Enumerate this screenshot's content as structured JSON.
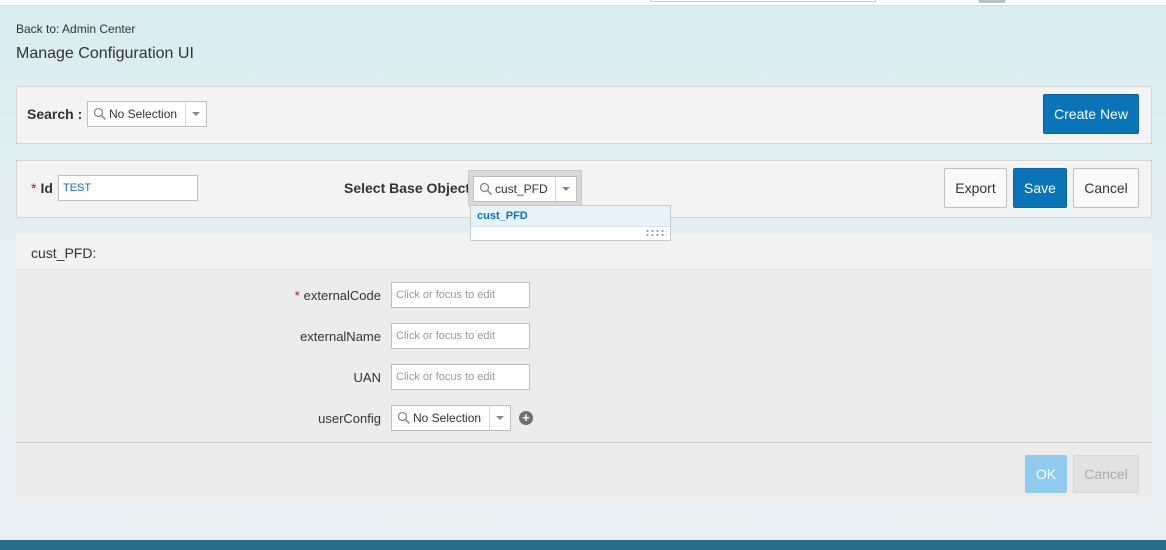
{
  "header": {
    "back_link": "Back to: Admin Center",
    "page_title": "Manage Configuration UI"
  },
  "search_bar": {
    "label": "Search :",
    "value": "No Selection",
    "create_button": "Create New"
  },
  "config_bar": {
    "id_label": "Id",
    "id_required": "*",
    "id_value": "TEST",
    "base_object_label": "Select Base Object",
    "base_object_value": "cust_PFD",
    "dropdown_options": [
      "cust_PFD"
    ],
    "export_button": "Export",
    "save_button": "Save",
    "cancel_button": "Cancel"
  },
  "section": {
    "title": "cust_PFD:",
    "fields": [
      {
        "label": "externalCode",
        "required": "*",
        "placeholder": "Click or focus to edit"
      },
      {
        "label": "externalName",
        "placeholder": "Click or focus to edit"
      },
      {
        "label": "UAN",
        "placeholder": "Click or focus to edit"
      },
      {
        "label": "userConfig",
        "value": "No Selection"
      }
    ],
    "ok_button": "OK",
    "cancel_button": "Cancel"
  },
  "colors": {
    "primary": "#0a74b8",
    "primary_disabled": "#8fcbef",
    "required": "#d0021b",
    "bottom_bar": "#2a6f8a"
  },
  "icons": [
    "search-icon",
    "chevron-down-icon",
    "add-circle-icon",
    "resize-grip-icon"
  ]
}
